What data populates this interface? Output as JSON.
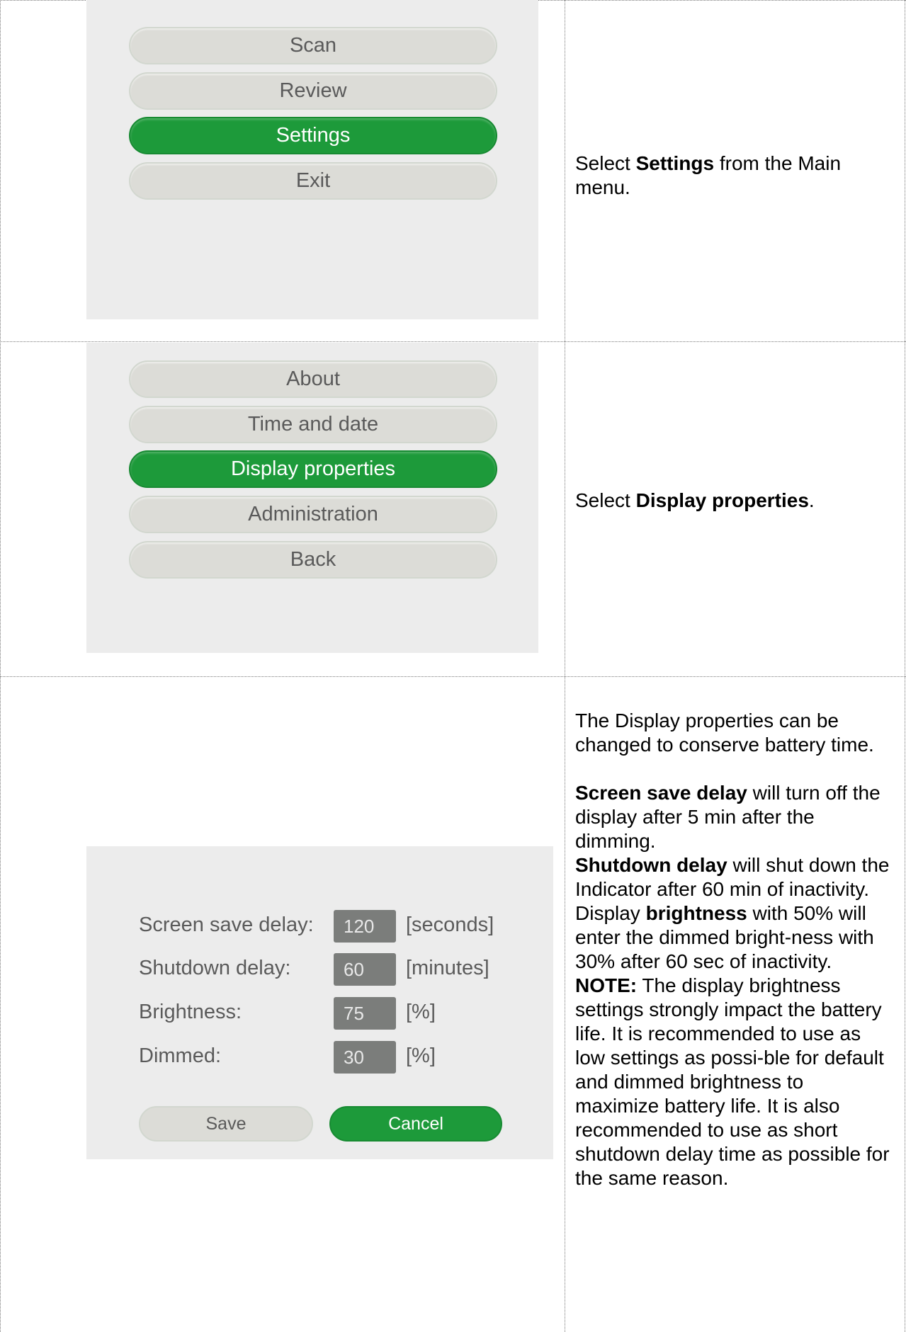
{
  "section1": {
    "menu": [
      "Scan",
      "Review",
      "Settings",
      "Exit"
    ],
    "active_index": 2,
    "desc_before": "Select ",
    "desc_bold": "Settings",
    "desc_after": " from the Main menu."
  },
  "section2": {
    "menu": [
      "About",
      "Time and date",
      "Display properties",
      "Administration",
      "Back"
    ],
    "active_index": 2,
    "desc_before": "Select ",
    "desc_bold": "Display properties",
    "desc_after": "."
  },
  "section3": {
    "fields": [
      {
        "label": "Screen save delay:",
        "value": "120",
        "unit": "[seconds]"
      },
      {
        "label": "Shutdown delay:",
        "value": "60",
        "unit": "[minutes]"
      },
      {
        "label": "Brightness:",
        "value": "75",
        "unit": "[%]"
      },
      {
        "label": "Dimmed:",
        "value": "30",
        "unit": "[%]"
      }
    ],
    "save_label": "Save",
    "cancel_label": "Cancel",
    "intro": "The Display properties can be changed to conserve battery time.",
    "screen_save_bold": "Screen save delay",
    "screen_save_text": " will turn off the display after 5 min after the dimming.",
    "shutdown_bold": "Shutdown delay",
    "shutdown_text": " will shut down the Indicator after 60 min of inactivity.",
    "brightness_pre": "Display ",
    "brightness_bold": "brightness",
    "brightness_text": " with 50% will enter the dimmed bright-ness with 30% after 60 sec of inactivity.",
    "note_bold": "NOTE:",
    "note_text": " The display brightness settings strongly impact the battery life. It is recommended to use as low settings as possi-ble for default and dimmed brightness to maximize battery life. It is also recommended to use as short shutdown delay time as possible for the same reason."
  },
  "colors": {
    "accent": "#1d9a3a",
    "button_bg": "#dcdcd7",
    "panel_bg": "#ececec",
    "field_bg": "#7b7d7b"
  }
}
